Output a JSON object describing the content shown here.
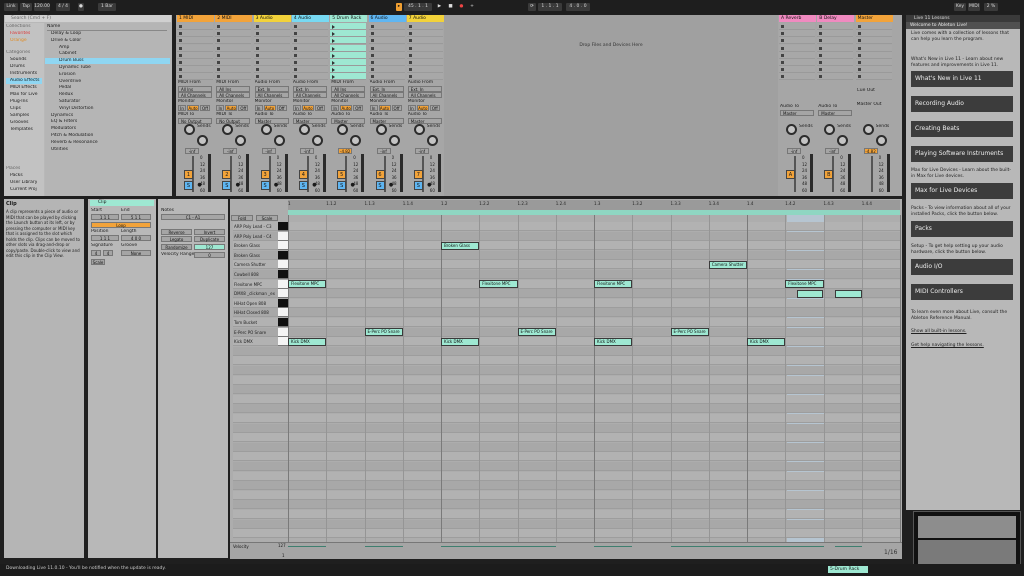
{
  "toolbar": {
    "link": "Link",
    "tap": "Tap",
    "tempo": "120.00",
    "meter": "4 / 4",
    "quant": "1 Bar",
    "position": "45 . 1 . 1",
    "punch_pos": "1 . 1 . 1",
    "loop_len": "4 . 0 . 0",
    "key": "Key",
    "midi": "MIDI",
    "cpu": "2 %"
  },
  "browser": {
    "search_placeholder": "Search (Cmd + F)",
    "collections_label": "Collections",
    "collections": [
      "Favorites",
      "Orange"
    ],
    "categories_label": "Categories",
    "categories": [
      "Sounds",
      "Drums",
      "Instruments",
      "Audio Effects",
      "MIDI Effects",
      "Max for Live",
      "Plug-Ins",
      "Clips",
      "Samples",
      "Grooves",
      "Templates"
    ],
    "places_label": "Places",
    "places": [
      "Packs",
      "User Library",
      "Current Proj"
    ],
    "name_header": "Name",
    "items": [
      "Delay & Loop",
      "Drive & Color",
      "Amp",
      "Cabinet",
      "Drum Buss",
      "Dynamic Tube",
      "Erosion",
      "Overdrive",
      "Pedal",
      "Redux",
      "Saturator",
      "Vinyl Distortion",
      "Dynamics",
      "EQ & Filters",
      "Modulators",
      "Pitch & Modulation",
      "Reverb & Resonance",
      "Utilities"
    ]
  },
  "tracks": [
    {
      "name": "1 MIDI",
      "color": "#f2a33a",
      "num": "1"
    },
    {
      "name": "2 MIDI",
      "color": "#f2a33a",
      "num": "2"
    },
    {
      "name": "3 Audio",
      "color": "#f2d23a",
      "num": "3"
    },
    {
      "name": "4 Audio",
      "color": "#77d9f2",
      "num": "4"
    },
    {
      "name": "5 Drum Rack",
      "color": "#9ee8d2",
      "num": "5"
    },
    {
      "name": "6 Audio",
      "color": "#5fb6f2",
      "num": "6"
    },
    {
      "name": "7 Audio",
      "color": "#f2d23a",
      "num": "7"
    }
  ],
  "returns": [
    {
      "name": "A Reverb",
      "color": "#f08ac0",
      "num": "A"
    },
    {
      "name": "B Delay",
      "color": "#f08ac0",
      "num": "B"
    },
    {
      "name": "Master",
      "color": "#f2a33a",
      "num": ""
    }
  ],
  "mixer": {
    "midi_from": "MIDI From",
    "all_ins": "All Ins",
    "all_channels": "All Channels",
    "audio_from": "Audio From",
    "ext_in": "Ext. In",
    "monitor": "Monitor",
    "in": "In",
    "auto": "Auto",
    "off": "Off",
    "midi_to": "MIDI To",
    "no_output": "No Output",
    "audio_to": "Audio To",
    "master": "Master",
    "sends": "Sends",
    "cue_out": "Cue Out",
    "master_out": "Master Out",
    "minus_inf": "-inf",
    "db_val": "-4.82",
    "scale": [
      "0",
      "12",
      "24",
      "36",
      "48",
      "60"
    ]
  },
  "drop_text": "Drop Files and Devices Here",
  "info": {
    "title": "Clip",
    "body": "A clip represents a piece of audio or MIDI that can be played by clicking the Launch button at its left, or by pressing the computer or MIDI key that is assigned to the slot which holds the clip. Clips can be moved to other slots via drag-and-drop or copy/paste. Double-click to view and edit this clip in the Clip View."
  },
  "clip_view": {
    "clip_label": "Clip",
    "start": "Start",
    "end": "End",
    "loop": "Loop",
    "position": "Position",
    "length": "Length",
    "signature": "Signature",
    "groove": "Groove",
    "none": "None",
    "sig_num": "4",
    "sig_den": "4",
    "start_val": "1 1 1",
    "end_val": "5 1 1",
    "pos_val": "1 1 1",
    "len_val": "4 0 0",
    "scale_label": "Scale",
    "notes_label": "Notes",
    "notes_range": "C1 - A1",
    "fold": "Fold",
    "scale_btn": "Scale",
    "reverse": "Reverse",
    "invert": "Invert",
    "legato": "Legato",
    "duplicate": "Duplicate",
    "randomize": "Randomize",
    "rand_val": "127",
    "velocity_range": "Velocity Range",
    "vel_range_val": "0"
  },
  "ruler": [
    "1",
    "1.1.2",
    "1.1.3",
    "1.1.4",
    "1.2",
    "1.2.2",
    "1.2.3",
    "1.2.4",
    "1.3",
    "1.3.2",
    "1.3.3",
    "1.3.4",
    "1.4",
    "1.4.2",
    "1.4.3",
    "1.4.4"
  ],
  "lanes": [
    "ARP Poly Lead - C3",
    "ARP Poly Lead - C4",
    "Broken Glass",
    "Broken Glass",
    "Camera Shutter",
    "Cowbell 808",
    "Flexitone MPC",
    "DMX8 _clickman _ex",
    "HiHat Open 808",
    "HiHat Closed 808",
    "Tom Bucket",
    "E-Perc PO Snare",
    "Kick DMX"
  ],
  "notes": [
    {
      "lane": 2,
      "beat": 2.0,
      "len": 0.5,
      "label": "Broken Glass"
    },
    {
      "lane": 4,
      "beat": 5.5,
      "len": 0.5,
      "label": "Camera Shutter"
    },
    {
      "lane": 6,
      "beat": 0.0,
      "len": 0.5,
      "label": "Flexitone MPC"
    },
    {
      "lane": 6,
      "beat": 2.5,
      "len": 0.5,
      "label": "Flexitone MPC"
    },
    {
      "lane": 6,
      "beat": 4.0,
      "len": 0.5,
      "label": "Flexitone MPC"
    },
    {
      "lane": 6,
      "beat": 6.5,
      "len": 0.5,
      "label": "Flexitone MPC"
    },
    {
      "lane": 7,
      "beat": 6.65,
      "len": 0.35,
      "label": ""
    },
    {
      "lane": 7,
      "beat": 7.15,
      "len": 0.35,
      "label": ""
    },
    {
      "lane": 11,
      "beat": 1.0,
      "len": 0.5,
      "label": "E-Perc PO Snare"
    },
    {
      "lane": 11,
      "beat": 3.0,
      "len": 0.5,
      "label": "E-Perc PO Snare"
    },
    {
      "lane": 11,
      "beat": 5.0,
      "len": 0.5,
      "label": "E-Perc PO Snare"
    },
    {
      "lane": 12,
      "beat": 0.0,
      "len": 0.5,
      "label": "Kick DMX"
    },
    {
      "lane": 12,
      "beat": 2.0,
      "len": 0.5,
      "label": "Kick DMX"
    },
    {
      "lane": 12,
      "beat": 4.0,
      "len": 0.5,
      "label": "Kick DMX"
    },
    {
      "lane": 12,
      "beat": 6.0,
      "len": 0.5,
      "label": "Kick DMX"
    }
  ],
  "velocity": {
    "label": "Velocity",
    "max": "127",
    "min": "1"
  },
  "page_indicator": "1/16",
  "lessons": {
    "header": "Live 11 Lessons",
    "welcome": "Welcome to Ableton Live!",
    "intro": "Live comes with a collection of lessons that can help you learn the program.",
    "whats_new_text": "What's New in Live 11 - Learn about new features and improvements in Live 11.",
    "buttons": [
      "What's New in Live 11",
      "Recording Audio",
      "Creating Beats",
      "Playing Software Instruments",
      "Max for Live Devices",
      "Packs",
      "Audio I/O",
      "MIDI Controllers"
    ],
    "max_text": "Max for Live Devices - Learn about the built-in Max for Live devices.",
    "packs_text": "Packs - To view information about all of your installed Packs, click the button below.",
    "setup_text": "Setup - To get help setting up your audio hardware, click the button below.",
    "manual_text": "To learn even more about Live, consult the Ableton Reference Manual.",
    "show_all": "Show all built-in lessons.",
    "help_nav": "Get help navigating the lessons."
  },
  "status": {
    "message": "Downloading Live 11.0.10 - You'll be notified when the update is ready.",
    "track": "5-Drum Rack"
  }
}
